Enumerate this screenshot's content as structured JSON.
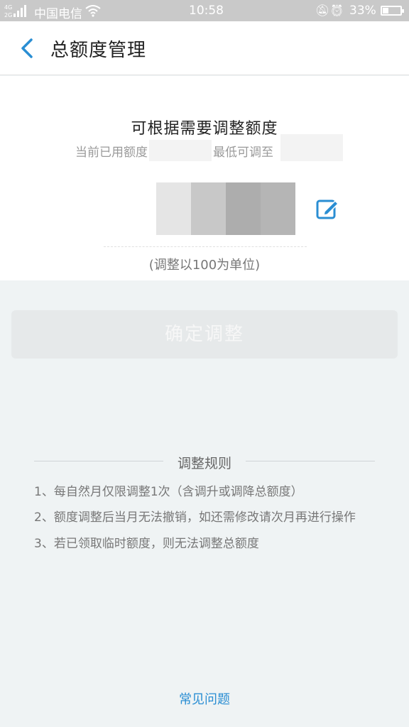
{
  "status_bar": {
    "network": "4G",
    "carrier": "中国电信",
    "time": "10:58",
    "battery": "33%",
    "battery_level": 0.33
  },
  "header": {
    "title": "总额度管理"
  },
  "card": {
    "headline": "可根据需要调整额度",
    "used_label": "当前已用额度",
    "min_label": "最低可调至",
    "unit_note": "(调整以100为单位)"
  },
  "confirm_button": {
    "label": "确定调整"
  },
  "rules": {
    "title": "调整规则",
    "items": [
      "1、每自然月仅限调整1次（含调升或调降总额度）",
      "2、额度调整后当月无法撤销，如还需修改请次月再进行操作",
      "3、若已领取临时额度，则无法调整总额度"
    ]
  },
  "faq": {
    "label": "常见问题"
  },
  "colors": {
    "accent": "#2a8ed3",
    "background": "#eff3f4",
    "status_bar": "#c9c9c9"
  }
}
